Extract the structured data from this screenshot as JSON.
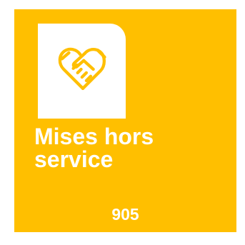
{
  "tile": {
    "title_line1": "Mises hors",
    "title_line2": "service",
    "count": "905",
    "icon": "handshake-icon",
    "background_color": "#FFBF00",
    "icon_color": "#FFBF00",
    "text_color": "#FFFFFF"
  }
}
